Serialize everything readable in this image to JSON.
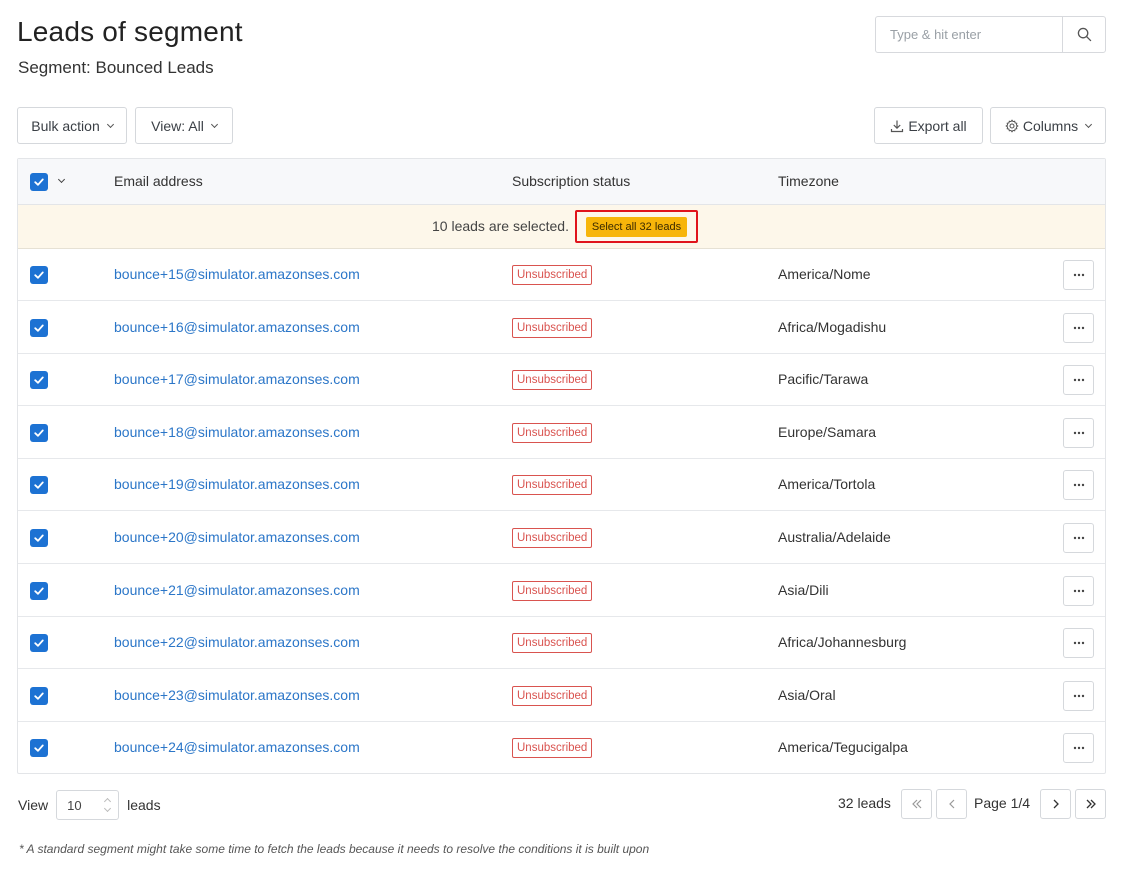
{
  "header": {
    "title": "Leads of segment",
    "subtitle": "Segment: Bounced Leads"
  },
  "search": {
    "placeholder": "Type & hit enter",
    "icon": "search-icon"
  },
  "toolbar": {
    "bulk_action": "Bulk action",
    "view": "View: All",
    "export": "Export all",
    "columns": "Columns"
  },
  "table": {
    "columns": [
      "Email address",
      "Subscription status",
      "Timezone"
    ],
    "selection_text": "10 leads are selected.",
    "select_all_label": "Select all 32 leads",
    "rows": [
      {
        "email": "bounce+15@simulator.amazonses.com",
        "status": "Unsubscribed",
        "timezone": "America/Nome"
      },
      {
        "email": "bounce+16@simulator.amazonses.com",
        "status": "Unsubscribed",
        "timezone": "Africa/Mogadishu"
      },
      {
        "email": "bounce+17@simulator.amazonses.com",
        "status": "Unsubscribed",
        "timezone": "Pacific/Tarawa"
      },
      {
        "email": "bounce+18@simulator.amazonses.com",
        "status": "Unsubscribed",
        "timezone": "Europe/Samara"
      },
      {
        "email": "bounce+19@simulator.amazonses.com",
        "status": "Unsubscribed",
        "timezone": "America/Tortola"
      },
      {
        "email": "bounce+20@simulator.amazonses.com",
        "status": "Unsubscribed",
        "timezone": "Australia/Adelaide"
      },
      {
        "email": "bounce+21@simulator.amazonses.com",
        "status": "Unsubscribed",
        "timezone": "Asia/Dili"
      },
      {
        "email": "bounce+22@simulator.amazonses.com",
        "status": "Unsubscribed",
        "timezone": "Africa/Johannesburg"
      },
      {
        "email": "bounce+23@simulator.amazonses.com",
        "status": "Unsubscribed",
        "timezone": "Asia/Oral"
      },
      {
        "email": "bounce+24@simulator.amazonses.com",
        "status": "Unsubscribed",
        "timezone": "America/Tegucigalpa"
      }
    ]
  },
  "footer": {
    "view_label": "View",
    "per_page": "10",
    "leads_label": "leads",
    "total": "32 leads",
    "page": "Page 1/4",
    "note": "* A standard segment might take some time to fetch the leads because it needs to resolve the conditions it is built upon"
  },
  "colors": {
    "accent": "#1d72d3",
    "link": "#2b76c8",
    "badge_danger": "#d9534f",
    "highlight_button": "#f7b50a",
    "selection_banner": "#fdf7ea",
    "annotation_box": "#e0141c"
  }
}
